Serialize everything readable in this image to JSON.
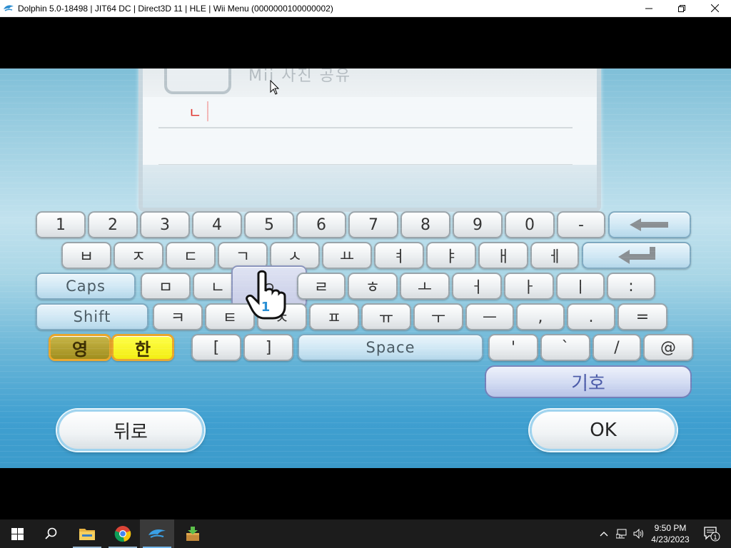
{
  "window": {
    "title": "Dolphin 5.0-18498 | JIT64 DC | Direct3D 11 | HLE | Wii Menu (0000000100000002)",
    "minimize_icon": "minimize-icon",
    "restore_icon": "restore-icon",
    "close_icon": "close-icon"
  },
  "panel": {
    "title": "Mii 사진 공유",
    "typed_text": "ㄴ"
  },
  "keyboard": {
    "row1": [
      "1",
      "2",
      "3",
      "4",
      "5",
      "6",
      "7",
      "8",
      "9",
      "0",
      "-"
    ],
    "backspace_icon": "backspace-arrow-icon",
    "row2": [
      "ㅂ",
      "ㅈ",
      "ㄷ",
      "ㄱ",
      "ㅅ",
      "ㅛ",
      "ㅕ",
      "ㅑ",
      "ㅐ",
      "ㅔ"
    ],
    "enter_icon": "enter-arrow-icon",
    "caps": "Caps",
    "row3": [
      "ㅁ",
      "ㄴ",
      "ㅇ",
      "ㄹ",
      "ㅎ",
      "ㅗ",
      "ㅓ",
      "ㅏ",
      "ㅣ",
      ":"
    ],
    "shift": "Shift",
    "row4": [
      "ㅋ",
      "ㅌ",
      "ㅊ",
      "ㅍ",
      "ㅠ",
      "ㅜ",
      "ㅡ",
      ",",
      ".",
      "="
    ],
    "lang_eng": "영",
    "lang_kor": "한",
    "row5_left": [
      "[",
      "]"
    ],
    "space": "Space",
    "row5_right": [
      "'",
      "`",
      "/",
      "@"
    ],
    "symbols": "기호"
  },
  "buttons": {
    "back": "뒤로",
    "ok": "OK"
  },
  "cursor": {
    "player_number": "1"
  },
  "taskbar": {
    "time": "9:50 PM",
    "date": "4/23/2023",
    "notification_count": "1"
  },
  "colors": {
    "accent_lang_active": "#f3ee13",
    "panel_text_red": "#e0302a",
    "taskbar_bg": "#1c1c1c"
  }
}
